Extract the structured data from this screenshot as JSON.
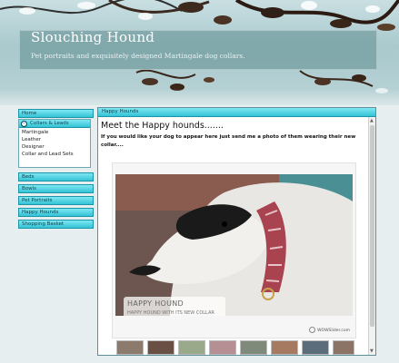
{
  "site": {
    "title": "Slouching Hound",
    "tagline": "Pet portraits and exquisitely designed Martingale dog collars."
  },
  "nav": {
    "home": "Home",
    "collars_leads": "Collars & Leads",
    "collars_sub": [
      "Martingale",
      "Leather",
      "Designer",
      "Collar and Lead Sets"
    ],
    "beds": "Beds",
    "bowls": "Bowls",
    "pet_portraits": "Pet Portraits",
    "happy_hounds": "Happy Hounds",
    "shopping_basket": "Shopping Basket"
  },
  "panel": {
    "title": "Happy Hounds",
    "heading": "Meet the Happy hounds.......",
    "intro": "If you would like your dog to appear here just send me a photo of them wearing their new collar...."
  },
  "slideshow": {
    "caption_title": "HAPPY HOUND",
    "caption_text": "HAPPY HOUND WITH ITS NEW COLLAR",
    "credit": "WOWSlider.com"
  },
  "colors": {
    "nav_accent": "#34c3d6",
    "banner": "#a9c9cd"
  }
}
